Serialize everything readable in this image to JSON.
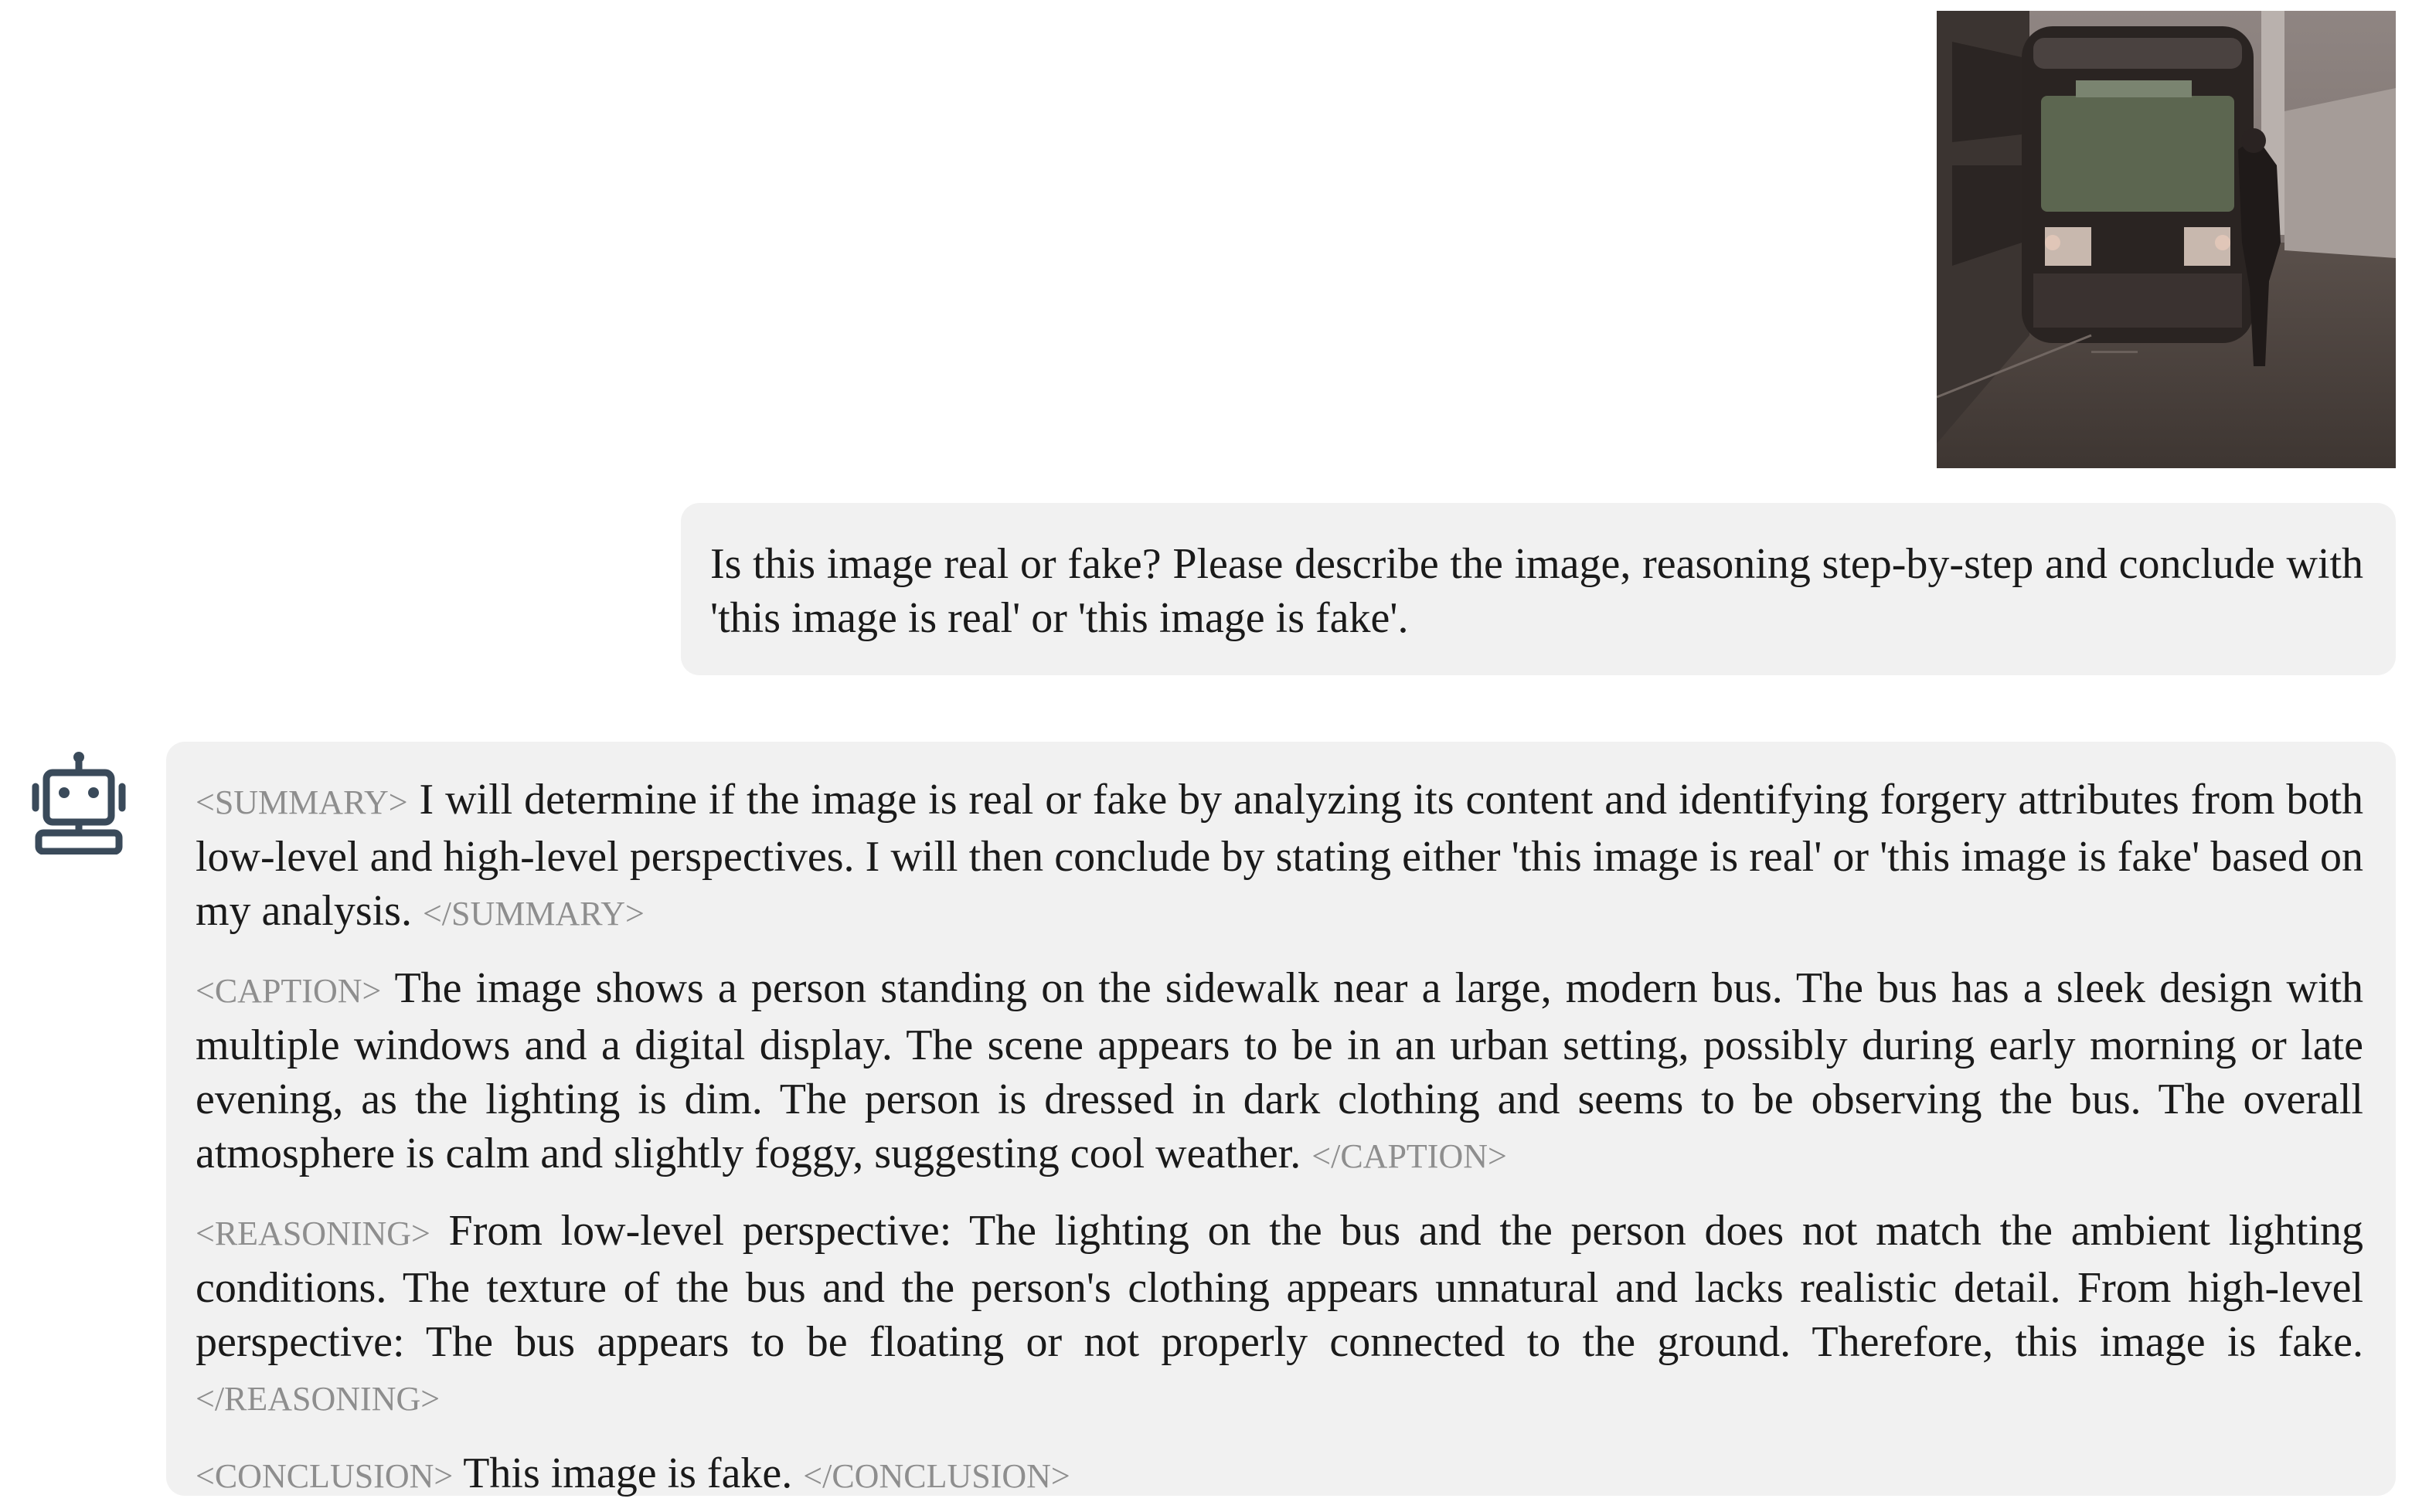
{
  "conversation": {
    "user": {
      "image": {
        "description_icon": "photo-thumbnail"
      },
      "message": "Is this image real or fake? Please describe the image, reasoning step-by-step and conclude with 'this image is real' or 'this image is fake'."
    },
    "assistant": {
      "avatar_icon": "robot-icon",
      "sections": {
        "summary": {
          "open_tag": "<SUMMARY>",
          "text": " I will determine if the image is real or fake by analyzing its content and identifying forgery attributes from both low-level and high-level perspectives. I will then conclude by stating either 'this image is real' or 'this image is fake' based on my analysis. ",
          "close_tag": "</SUMMARY>"
        },
        "caption": {
          "open_tag": "<CAPTION>",
          "text": " The image shows a person standing on the sidewalk near a large, modern bus. The bus has a sleek design with multiple windows and a digital display. The scene appears to be in an urban setting, possibly during early morning or late evening, as the lighting is dim. The person is dressed in dark clothing and seems to be observing the bus. The overall atmosphere is calm and slightly foggy, suggesting cool weather. ",
          "close_tag": "</CAPTION>"
        },
        "reasoning": {
          "open_tag": "<REASONING>",
          "text": " From low-level perspective: The lighting on the bus and the person does not match the ambient lighting conditions. The texture of the bus and the person's clothing appears unnatural and lacks realistic detail. From high-level perspective: The bus appears to be floating or not properly connected to the ground. Therefore, this image is fake. ",
          "close_tag": "</REASONING>"
        },
        "conclusion": {
          "open_tag": "<CONCLUSION>",
          "text": " This image is fake. ",
          "close_tag": "</CONCLUSION>"
        }
      }
    }
  },
  "colors": {
    "bubble_bg": "#f1f1f1",
    "tag_gray": "#8e8e8e",
    "text": "#1a1a1a",
    "robot_icon": "#3a4a5a"
  }
}
